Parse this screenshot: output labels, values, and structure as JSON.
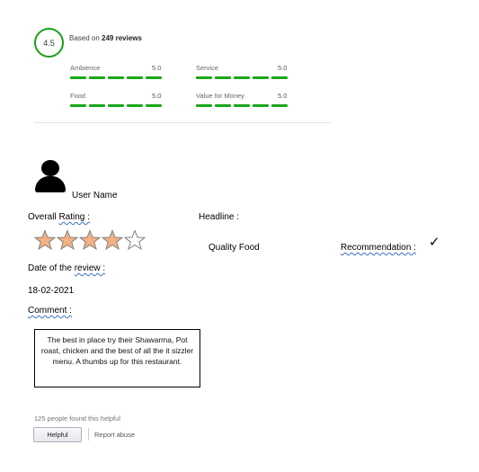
{
  "summary": {
    "score": "4.5",
    "based_prefix": "Based on ",
    "review_count": "249 reviews",
    "categories": [
      {
        "label": "Ambience",
        "score": "5.0"
      },
      {
        "label": "Service",
        "score": "5.0"
      },
      {
        "label": "Food",
        "score": "5.0"
      },
      {
        "label": "Value for Money",
        "score": "5.0"
      }
    ]
  },
  "review": {
    "user_name": "User Name",
    "overall_label": "Overall ",
    "rating_word": "Rating :",
    "rating_value": 4,
    "rating_max": 5,
    "headline_label": "Headline :",
    "headline_value": "Quality Food",
    "recommendation_label": "Recommendation :",
    "recommendation_mark": "✓",
    "date_label": "Date of the ",
    "date_word": "review :",
    "date_value": "18-02-2021",
    "comment_label": "Comment :",
    "comment_text": "The best in place try their Shawarma, Pot roast, chicken and the best of all the it sizzler menu. A thumbs up for this restaurant."
  },
  "footer": {
    "helpful_count": "125 people found this helpful",
    "helpful_button": "Helpful",
    "report_abuse": "Report abuse"
  },
  "colors": {
    "accent_green": "#18a818",
    "star_fill": "#f4b183",
    "star_stroke": "#7f7f7f"
  }
}
